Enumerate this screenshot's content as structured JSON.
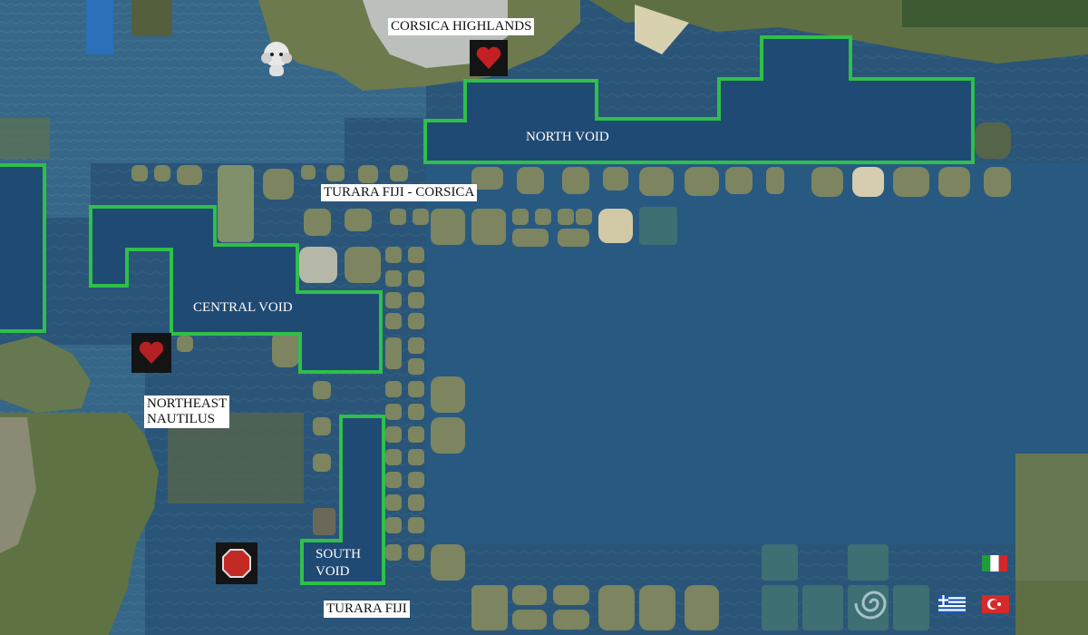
{
  "map": {
    "region_labels": {
      "corsica_highlands": "CORSICA HIGHLANDS",
      "turara_fiji_corsica": "TURARA FIJI - CORSICA",
      "northeast_nautilus": "NORTHEAST\nNAUTILUS",
      "turara_fiji": "TURARA FIJI"
    },
    "void_labels": {
      "north_void": "NORTH VOID",
      "central_void": "CENTRAL VOID",
      "south_void": "SOUTH\nVOID"
    },
    "colors": {
      "ocean": "#2a5578",
      "void_fill": "#1f4a74",
      "void_outline": "#2fbf4a",
      "land": "#6c7a4d",
      "label_bg": "#ffffff"
    },
    "icons": [
      "heart-icon",
      "octagon-icon",
      "poodle-icon",
      "italy-flag-icon",
      "greece-flag-icon",
      "turkey-flag-icon",
      "spiral-icon"
    ]
  }
}
